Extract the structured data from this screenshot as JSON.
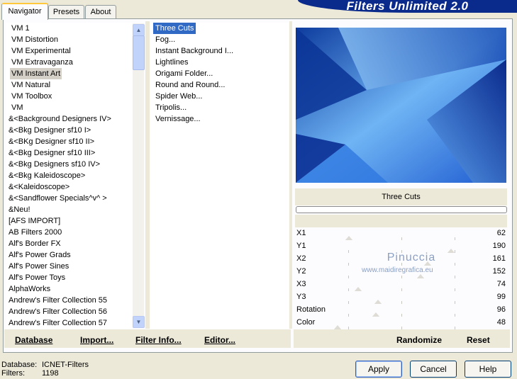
{
  "tabs": [
    {
      "label": "Navigator",
      "active": true
    },
    {
      "label": "Presets",
      "active": false
    },
    {
      "label": "About",
      "active": false
    }
  ],
  "banner_title": "Filters Unlimited 2.0",
  "categories": [
    "VM 1",
    "VM Distortion",
    "VM Experimental",
    "VM Extravaganza",
    "VM Instant Art",
    "VM Natural",
    "VM Toolbox",
    "VM",
    "&<Background Designers IV>",
    "&<Bkg Designer sf10 I>",
    "&<BKg Designer sf10 II>",
    "&<Bkg Designer sf10 III>",
    "&<Bkg Designers sf10 IV>",
    "&<Bkg Kaleidoscope>",
    "&<Kaleidoscope>",
    "&<Sandflower Specials^v^ >",
    "&Neu!",
    "[AFS IMPORT]",
    "AB Filters 2000",
    "Alf's Border FX",
    "Alf's Power Grads",
    "Alf's Power Sines",
    "Alf's Power Toys",
    "AlphaWorks",
    "Andrew's Filter Collection 55",
    "Andrew's Filter Collection 56",
    "Andrew's Filter Collection 57"
  ],
  "selected_category": "VM Instant Art",
  "filters": [
    "Three Cuts",
    "Fog...",
    "Instant Background I...",
    "Lightlines",
    "Origami Folder...",
    "Round and Round...",
    "Spider Web...",
    "Tripolis...",
    "Vernissage..."
  ],
  "selected_filter": "Three Cuts",
  "bottom_links": {
    "database": "Database",
    "import": "Import...",
    "filter_info": "Filter Info...",
    "editor": "Editor..."
  },
  "preview_title": "Three Cuts",
  "sliders": [
    {
      "label": "X1",
      "value": 62
    },
    {
      "label": "Y1",
      "value": 190
    },
    {
      "label": "X2",
      "value": 161
    },
    {
      "label": "Y2",
      "value": 152
    },
    {
      "label": "X3",
      "value": 74
    },
    {
      "label": "Y3",
      "value": 99
    },
    {
      "label": "Rotation",
      "value": 96
    },
    {
      "label": "Color",
      "value": 48
    }
  ],
  "randomize_label": "Randomize",
  "reset_label": "Reset",
  "watermark": {
    "line1": "Pinuccia",
    "line2": "www.maidiregrafica.eu"
  },
  "status": {
    "database_label": "Database:",
    "database_value": "ICNET-Filters",
    "filters_label": "Filters:",
    "filters_value": "1198"
  },
  "buttons": {
    "apply": "Apply",
    "cancel": "Cancel",
    "help": "Help"
  },
  "colors": {
    "selection": "#316ac5",
    "tab_highlight": "#ffc83c",
    "banner": "#0a2a8c"
  }
}
